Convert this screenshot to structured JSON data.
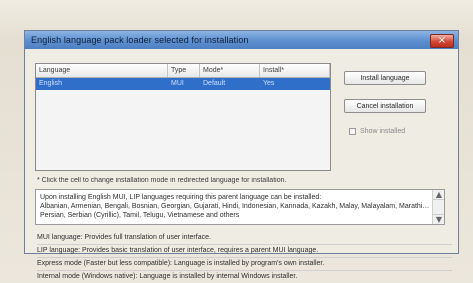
{
  "window": {
    "title": "English language pack loader selected for installation"
  },
  "list": {
    "headers": [
      "Language",
      "Type",
      "Mode*",
      "Install*"
    ],
    "rows": [
      [
        "English",
        "MUI",
        "Default",
        "Yes"
      ]
    ]
  },
  "buttons": {
    "install": "Install language",
    "cancel": "Cancel installation"
  },
  "options": {
    "show_installed": "Show installed"
  },
  "hint_text": "* Click the cell to change installation mode in redirected language for installation.",
  "info_box": {
    "line1": "Upon installing English MUI, LIP languages requiring this parent language can be installed:",
    "line2": "Albanian, Armenian, Bengali, Bosnian, Georgian, Gujarati, Hindi, Indonesian, Kannada, Kazakh, Malay, Malayalam, Marathi, Oriya,",
    "line3": "Persian, Serbian (Cyrillic), Tamil, Telugu, Vietnamese and others"
  },
  "definitions": [
    "MUI language: Provides full translation of user interface.",
    "LIP language: Provides basic translation of user interface, requires a parent MUI language.",
    "Express mode (Faster but less compatible): Language is installed by program's own installer.",
    "Internal mode (Windows native): Language is installed by internal Windows installer."
  ]
}
